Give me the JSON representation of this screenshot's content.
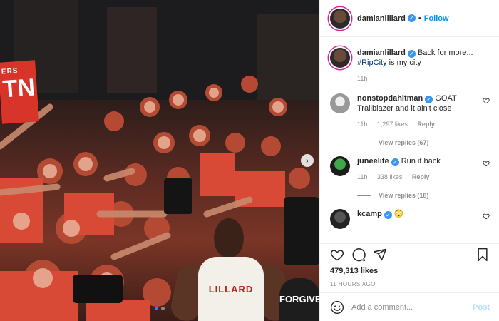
{
  "post": {
    "author": "damianlillard",
    "follow_label": "Follow",
    "separator": "•",
    "photo": {
      "sign_text": "TN",
      "sign_small": "ERS",
      "jersey_name": "LILLARD",
      "shirt_text": "FORGIVE",
      "next_icon": "›",
      "slides": 2,
      "active_slide": 0
    }
  },
  "caption": {
    "username": "damianlillard",
    "text_before": "Back for more...",
    "hashtag": "#RipCity",
    "text_after": " is my city",
    "time": "11h"
  },
  "comments": [
    {
      "username": "nonstopdahitman",
      "verified": true,
      "text": "GOAT Trailblazer and it ain't close",
      "time": "11h",
      "likes": "1,297 likes",
      "reply_label": "Reply",
      "view_replies": "View replies (67)"
    },
    {
      "username": "juneelite",
      "verified": true,
      "text": "Run it back",
      "time": "11h",
      "likes": "338 likes",
      "reply_label": "Reply",
      "view_replies": "View replies (18)"
    },
    {
      "username": "kcamp",
      "verified": true,
      "text": "😳",
      "time": "",
      "likes": "",
      "reply_label": "",
      "view_replies": ""
    }
  ],
  "actions": {
    "icons": [
      "heart-icon",
      "comment-icon",
      "share-icon",
      "bookmark-icon"
    ],
    "likes": "479,313 likes",
    "timestamp": "11 HOURS AGO"
  },
  "composer": {
    "placeholder": "Add a comment...",
    "post_label": "Post",
    "emoji_icon": "smile-icon"
  },
  "colors": {
    "accent": "#0095f6",
    "verified": "#3897f0",
    "hashtag": "#00376b",
    "muted": "#8e8e8e",
    "post_disabled": "#b2dffc"
  }
}
